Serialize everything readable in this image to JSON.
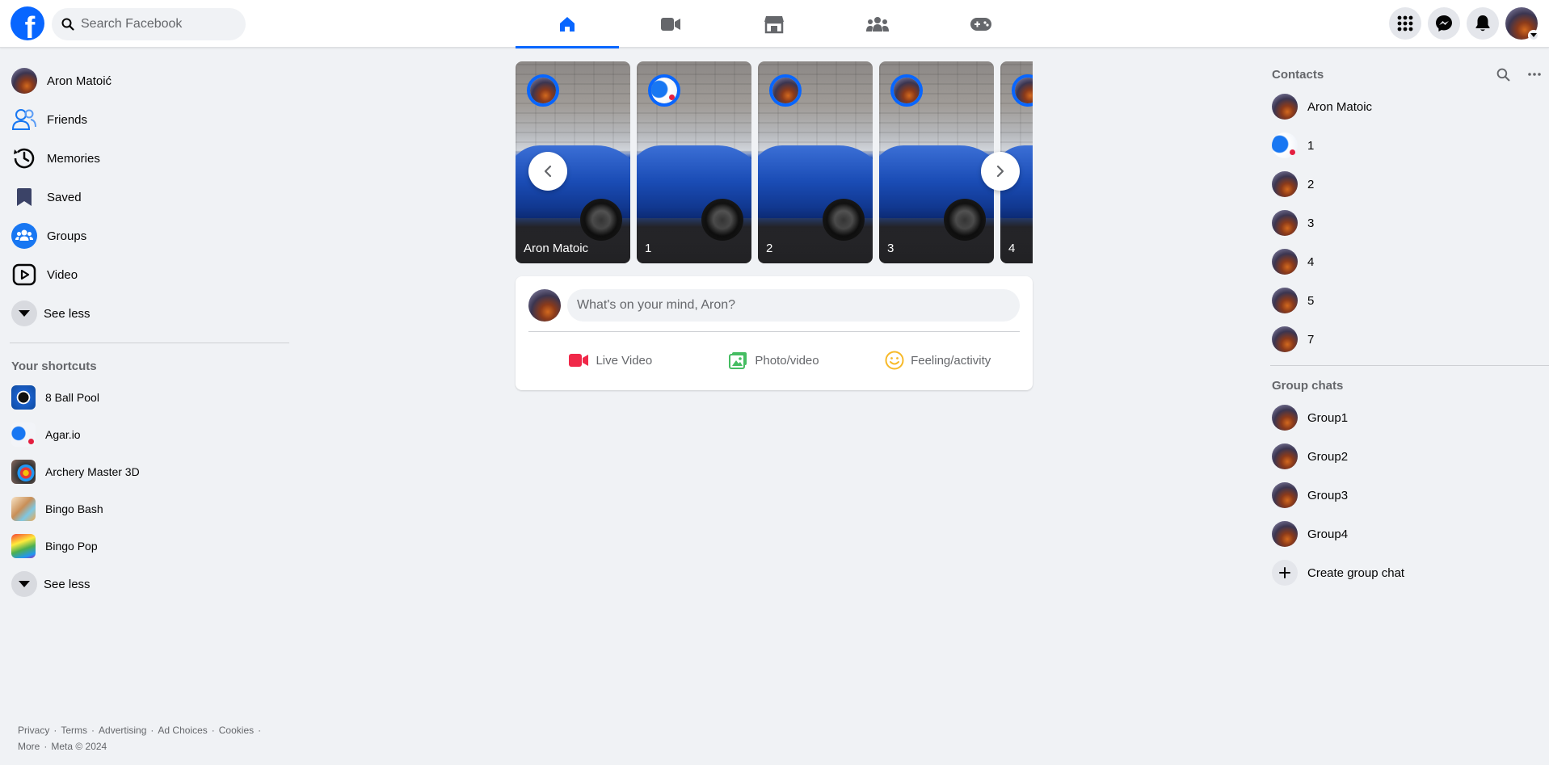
{
  "header": {
    "logo_letter": "f",
    "search_placeholder": "Search Facebook",
    "nav_tabs": [
      {
        "name": "home",
        "icon": "home-icon",
        "active": true
      },
      {
        "name": "video",
        "icon": "video-icon",
        "active": false
      },
      {
        "name": "marketplace",
        "icon": "marketplace-icon",
        "active": false
      },
      {
        "name": "groups",
        "icon": "groups-icon",
        "active": false
      },
      {
        "name": "gaming",
        "icon": "gaming-icon",
        "active": false
      }
    ],
    "right_buttons": [
      "menu-grid-icon",
      "messenger-icon",
      "notifications-icon",
      "account-avatar"
    ]
  },
  "left_nav": {
    "items": [
      {
        "label": "Aron Matoić",
        "icon": "profile-avatar"
      },
      {
        "label": "Friends",
        "icon": "friends-icon"
      },
      {
        "label": "Memories",
        "icon": "memories-icon"
      },
      {
        "label": "Saved",
        "icon": "saved-icon"
      },
      {
        "label": "Groups",
        "icon": "groups-icon"
      },
      {
        "label": "Video",
        "icon": "video-icon"
      },
      {
        "label": "See less",
        "icon": "chevron-down-icon"
      }
    ],
    "shortcuts_title": "Your shortcuts",
    "shortcuts": [
      {
        "label": "8 Ball Pool",
        "icon": "8-ball-pool-icon"
      },
      {
        "label": "Agar.io",
        "icon": "agario-icon"
      },
      {
        "label": "Archery Master 3D",
        "icon": "archery-icon"
      },
      {
        "label": "Bingo Bash",
        "icon": "bingo-bash-icon"
      },
      {
        "label": "Bingo Pop",
        "icon": "bingo-pop-icon"
      }
    ],
    "shortcuts_see_less": "See less"
  },
  "footer": {
    "links": [
      "Privacy",
      "Terms",
      "Advertising",
      "Ad Choices",
      "Cookies",
      "More"
    ],
    "copyright": "Meta © 2024",
    "separator": "·"
  },
  "stories": [
    {
      "name": "Aron Matoic",
      "avatar": "profile"
    },
    {
      "name": "1",
      "avatar": "alt"
    },
    {
      "name": "2",
      "avatar": "profile"
    },
    {
      "name": "3",
      "avatar": "profile"
    },
    {
      "name": "4",
      "avatar": "profile"
    }
  ],
  "composer": {
    "placeholder": "What's on your mind, Aron?",
    "actions": [
      {
        "label": "Live Video",
        "icon": "live-video-icon",
        "color": "#f02849"
      },
      {
        "label": "Photo/video",
        "icon": "photo-video-icon",
        "color": "#45bd62"
      },
      {
        "label": "Feeling/activity",
        "icon": "feeling-icon",
        "color": "#f7b928"
      }
    ]
  },
  "contacts": {
    "title": "Contacts",
    "items": [
      {
        "label": "Aron Matoic",
        "avatar": "profile"
      },
      {
        "label": "1",
        "avatar": "alt"
      },
      {
        "label": "2",
        "avatar": "profile"
      },
      {
        "label": "3",
        "avatar": "profile"
      },
      {
        "label": "4",
        "avatar": "profile"
      },
      {
        "label": "5",
        "avatar": "profile"
      },
      {
        "label": "7",
        "avatar": "profile"
      }
    ]
  },
  "group_chats": {
    "title": "Group chats",
    "items": [
      {
        "label": "Group1"
      },
      {
        "label": "Group2"
      },
      {
        "label": "Group3"
      },
      {
        "label": "Group4"
      }
    ],
    "create_label": "Create group chat"
  },
  "colors": {
    "brand": "#0866ff",
    "background": "#f0f2f5",
    "secondary_text": "#65676b"
  }
}
